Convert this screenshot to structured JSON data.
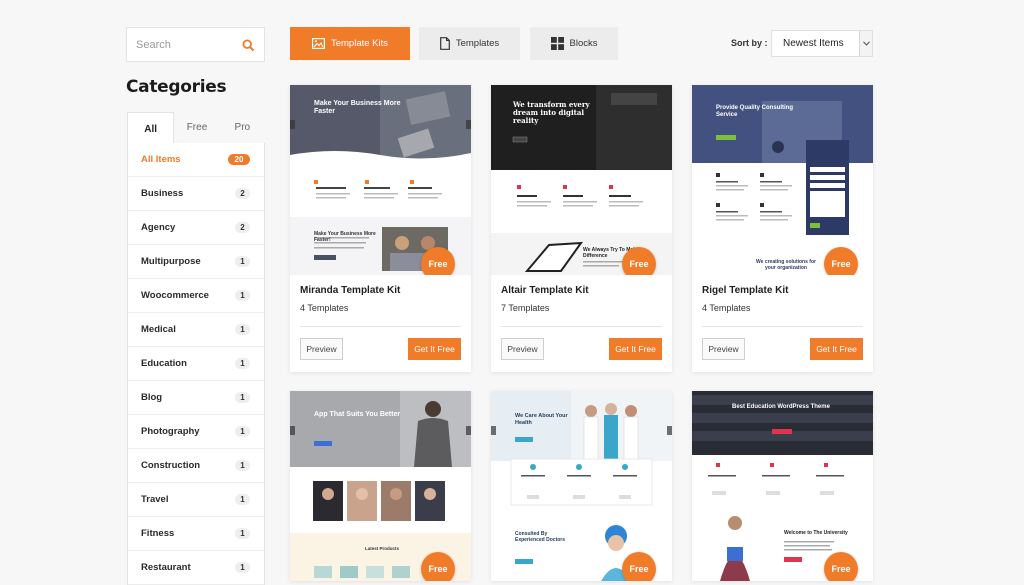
{
  "search": {
    "placeholder": "Search"
  },
  "categories": {
    "title": "Categories",
    "tabs": [
      "All",
      "Free",
      "Pro"
    ],
    "items": [
      {
        "label": "All Items",
        "count": "20"
      },
      {
        "label": "Business",
        "count": "2"
      },
      {
        "label": "Agency",
        "count": "2"
      },
      {
        "label": "Multipurpose",
        "count": "1"
      },
      {
        "label": "Woocommerce",
        "count": "1"
      },
      {
        "label": "Medical",
        "count": "1"
      },
      {
        "label": "Education",
        "count": "1"
      },
      {
        "label": "Blog",
        "count": "1"
      },
      {
        "label": "Photography",
        "count": "1"
      },
      {
        "label": "Construction",
        "count": "1"
      },
      {
        "label": "Travel",
        "count": "1"
      },
      {
        "label": "Fitness",
        "count": "1"
      },
      {
        "label": "Restaurant",
        "count": "1"
      }
    ]
  },
  "toolbar": {
    "tabs": [
      {
        "label": "Template Kits",
        "icon": "image-icon"
      },
      {
        "label": "Templates",
        "icon": "document-icon"
      },
      {
        "label": "Blocks",
        "icon": "grid-icon"
      }
    ],
    "sort_label": "Sort by :",
    "sort_value": "Newest Items"
  },
  "cards": [
    {
      "name": "Miranda Template Kit",
      "count": "4 Templates",
      "badge": "Free",
      "preview": "Preview",
      "get": "Get It Free",
      "thumb": {
        "headline": "Make Your Business More Faster",
        "section": "Make Your Business More Faster!"
      }
    },
    {
      "name": "Altair Template Kit",
      "count": "7 Templates",
      "badge": "Free",
      "preview": "Preview",
      "get": "Get It Free",
      "thumb": {
        "headline": "We transform every dream into digital reality",
        "section": "We Always Try To Make Difference"
      }
    },
    {
      "name": "Rigel Template Kit",
      "count": "4 Templates",
      "badge": "Free",
      "preview": "Preview",
      "get": "Get It Free",
      "thumb": {
        "headline": "Provide Quality Consulting Service",
        "section": "We creating solutions for your organization"
      }
    },
    {
      "badge": "Free",
      "thumb": {
        "headline": "App That Suits You Better",
        "section": "Latest Products"
      }
    },
    {
      "badge": "Free",
      "thumb": {
        "headline": "We Care About Your Health",
        "section": "Consulted By Experienced Doctors"
      }
    },
    {
      "badge": "Free",
      "thumb": {
        "headline": "Best Education WordPress Theme",
        "section": "Welcome to The University"
      }
    }
  ],
  "colors": {
    "accent": "#f07c2a"
  }
}
